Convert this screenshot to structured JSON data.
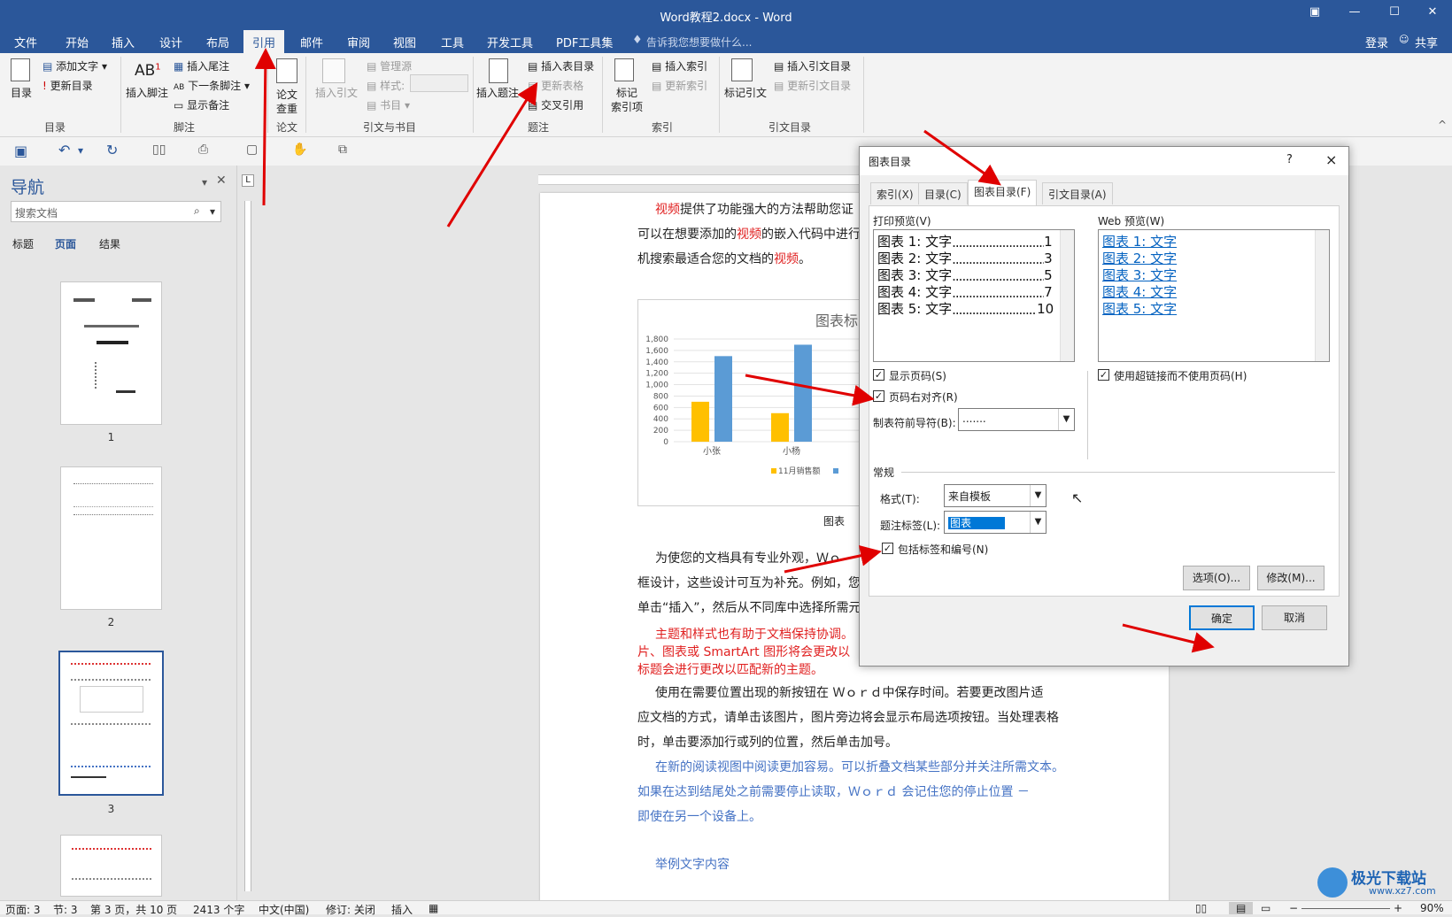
{
  "window": {
    "title": "Word教程2.docx - Word",
    "login": "登录",
    "share": "共享",
    "search_hint": "告诉我您想要做什么..."
  },
  "tabs": [
    "文件",
    "开始",
    "插入",
    "设计",
    "布局",
    "引用",
    "邮件",
    "审阅",
    "视图",
    "工具",
    "开发工具",
    "PDF工具集"
  ],
  "active_tab": "引用",
  "ribbon": {
    "toc": {
      "btn": "目录",
      "add_text": "添加文字",
      "update": "更新目录",
      "group": "目录"
    },
    "footnote": {
      "insert_footnote": "插入脚注",
      "insert_endnote": "插入尾注",
      "next_footnote": "下一条脚注",
      "show_notes": "显示备注",
      "group": "脚注"
    },
    "paper": {
      "btn1": "论文",
      "btn2": "查重",
      "group": "论文"
    },
    "citation": {
      "insert": "插入引文",
      "manage": "管理源",
      "style": "样式:",
      "bib": "书目",
      "group": "引文与书目"
    },
    "caption": {
      "insert": "插入题注",
      "insert_tof": "插入表目录",
      "update_table": "更新表格",
      "cross_ref": "交叉引用",
      "group": "题注"
    },
    "index": {
      "mark1": "标记",
      "mark2": "索引项",
      "insert": "插入索引",
      "update": "更新索引",
      "group": "索引"
    },
    "toa": {
      "mark": "标记引文",
      "insert": "插入引文目录",
      "update": "更新引文目录",
      "group": "引文目录"
    }
  },
  "nav": {
    "title": "导航",
    "search_placeholder": "搜索文档",
    "tabs": [
      "标题",
      "页面",
      "结果"
    ],
    "active": "页面",
    "pages": [
      "1",
      "2",
      "3"
    ]
  },
  "document": {
    "para1": [
      "视频",
      "提供了功能强大的方法帮助您证",
      "可以在想要添加的",
      "视频",
      "的嵌入代码中进行",
      "机搜索最适合您的文档的",
      "视频",
      "。"
    ],
    "chart": {
      "title": "图表标",
      "caption": "图表",
      "legend": "11月销售额"
    },
    "para2": [
      "为使您的文档具有专业外观，Ｗｏ",
      "框设计，这些设计可互为补充。例如，您",
      "单击“插入”，然后从不同库中选择所需元"
    ],
    "para3": [
      "主题和样式也有助于文档保持协调。",
      "片、图表或 SmartArt 图形将会更改以",
      "标题会进行更改以匹配新的主题。"
    ],
    "para4": [
      "使用在需要位置出现的新按钮在 Ｗｏｒｄ中保存时间。若要更改图片适",
      "应文档的方式，请单击该图片，图片旁边将会显示布局选项按钮。当处理表格",
      "时，单击要添加行或列的位置，然后单击加号。"
    ],
    "para5": [
      "在新的阅读视图中阅读更加容易。可以折叠文档某些部分并关注所需文本。",
      "如果在达到结尾处之前需要停止读取，Ｗｏｒｄ 会记住您的停止位置 －",
      "即使在另一个设备上。"
    ],
    "example": "举例文字内容"
  },
  "chart_data": {
    "type": "bar",
    "title": "图表标",
    "categories": [
      "小张",
      "小杨"
    ],
    "series": [
      {
        "name": "11月销售额",
        "values": [
          700,
          500
        ],
        "color": "#ffc000"
      },
      {
        "name": "",
        "values": [
          1500,
          1700
        ],
        "color": "#5b9bd5"
      }
    ],
    "ylim": [
      0,
      1800
    ],
    "yticks": [
      "0",
      "200",
      "400",
      "600",
      "800",
      "1,000",
      "1,200",
      "1,400",
      "1,600",
      "1,800"
    ]
  },
  "dialog": {
    "title": "图表目录",
    "help": "?",
    "close": "×",
    "tabs": [
      "索引(X)",
      "目录(C)",
      "图表目录(F)",
      "引文目录(A)"
    ],
    "active_tab": "图表目录(F)",
    "print_preview_label": "打印预览(V)",
    "web_preview_label": "Web 预览(W)",
    "print_rows": [
      {
        "t": "图表 1: 文字",
        "p": "1"
      },
      {
        "t": "图表 2: 文字",
        "p": "3"
      },
      {
        "t": "图表 3: 文字",
        "p": "5"
      },
      {
        "t": "图表 4: 文字",
        "p": "7"
      },
      {
        "t": "图表 5: 文字",
        "p": "10"
      }
    ],
    "web_rows": [
      "图表 1: 文字",
      "图表 2: 文字",
      "图表 3: 文字",
      "图表 4: 文字",
      "图表 5: 文字"
    ],
    "show_page_numbers": "显示页码(S)",
    "right_align": "页码右对齐(R)",
    "use_hyperlinks": "使用超链接而不使用页码(H)",
    "tab_leader_label": "制表符前导符(B):",
    "tab_leader_value": ".......",
    "general": "常规",
    "format_label": "格式(T):",
    "format_value": "来自模板",
    "caption_label": "题注标签(L):",
    "caption_value": "图表",
    "include_label": "包括标签和编号(N)",
    "options_btn": "选项(O)...",
    "modify_btn": "修改(M)...",
    "ok_btn": "确定",
    "cancel_btn": "取消"
  },
  "status": {
    "page": "页面: 3",
    "section": "节: 3",
    "pages": "第 3 页，共 10 页",
    "words": "2413 个字",
    "lang": "中文(中国)",
    "track": "修订: 关闭",
    "mode": "插入",
    "zoom": "90%"
  },
  "watermark": "极光下载站",
  "watermark_url": "www.xz7.com"
}
